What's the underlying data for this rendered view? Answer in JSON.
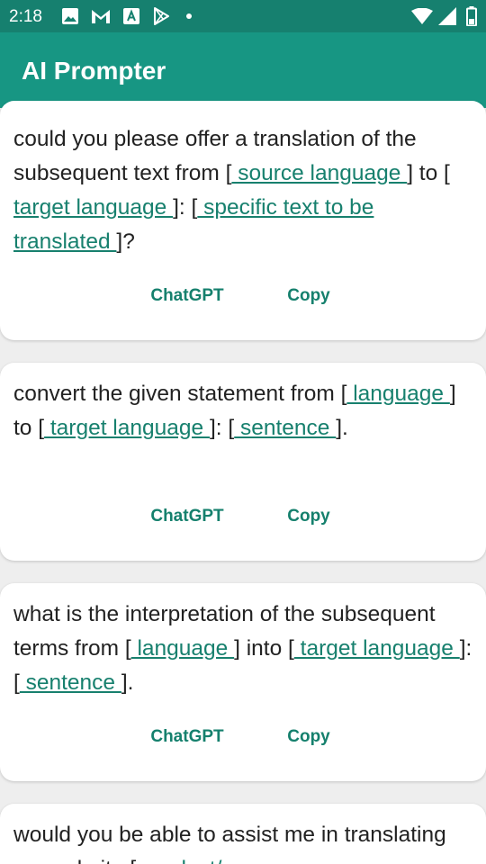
{
  "status_bar": {
    "time": "2:18",
    "icons": [
      "image-icon",
      "gmail-icon",
      "app-store-icon",
      "play-store-icon",
      "dot-icon",
      "wifi-icon",
      "signal-icon",
      "battery-icon"
    ]
  },
  "app_bar": {
    "title": "AI Prompter"
  },
  "actions": {
    "chatgpt_label": "ChatGPT",
    "copy_label": "Copy"
  },
  "colors": {
    "app_bar": "#179683",
    "status_bar": "#16806f",
    "accent": "#17806e",
    "background": "#eeeeee"
  },
  "cards": [
    {
      "segments": [
        {
          "t": "could you please offer a translation of the subsequent text from [",
          "ph": false
        },
        {
          "t": " source language ",
          "ph": true
        },
        {
          "t": "] to [",
          "ph": false
        },
        {
          "t": " target language ",
          "ph": true
        },
        {
          "t": "]: [",
          "ph": false
        },
        {
          "t": " specific text to be translated ",
          "ph": true
        },
        {
          "t": "]?",
          "ph": false
        }
      ]
    },
    {
      "segments": [
        {
          "t": "convert the given statement from [",
          "ph": false
        },
        {
          "t": " language ",
          "ph": true
        },
        {
          "t": "] to [",
          "ph": false
        },
        {
          "t": " target language ",
          "ph": true
        },
        {
          "t": "]: [",
          "ph": false
        },
        {
          "t": " sentence ",
          "ph": true
        },
        {
          "t": "].",
          "ph": false
        }
      ]
    },
    {
      "segments": [
        {
          "t": "what is the interpretation of the subsequent terms from [",
          "ph": false
        },
        {
          "t": " language ",
          "ph": true
        },
        {
          "t": "] into [",
          "ph": false
        },
        {
          "t": " target language ",
          "ph": true
        },
        {
          "t": "]: [",
          "ph": false
        },
        {
          "t": " sentence ",
          "ph": true
        },
        {
          "t": "].",
          "ph": false
        }
      ]
    },
    {
      "segments": [
        {
          "t": "would you be able to assist me in translating my website [",
          "ph": false
        },
        {
          "t": " product/",
          "ph": true
        }
      ]
    }
  ]
}
